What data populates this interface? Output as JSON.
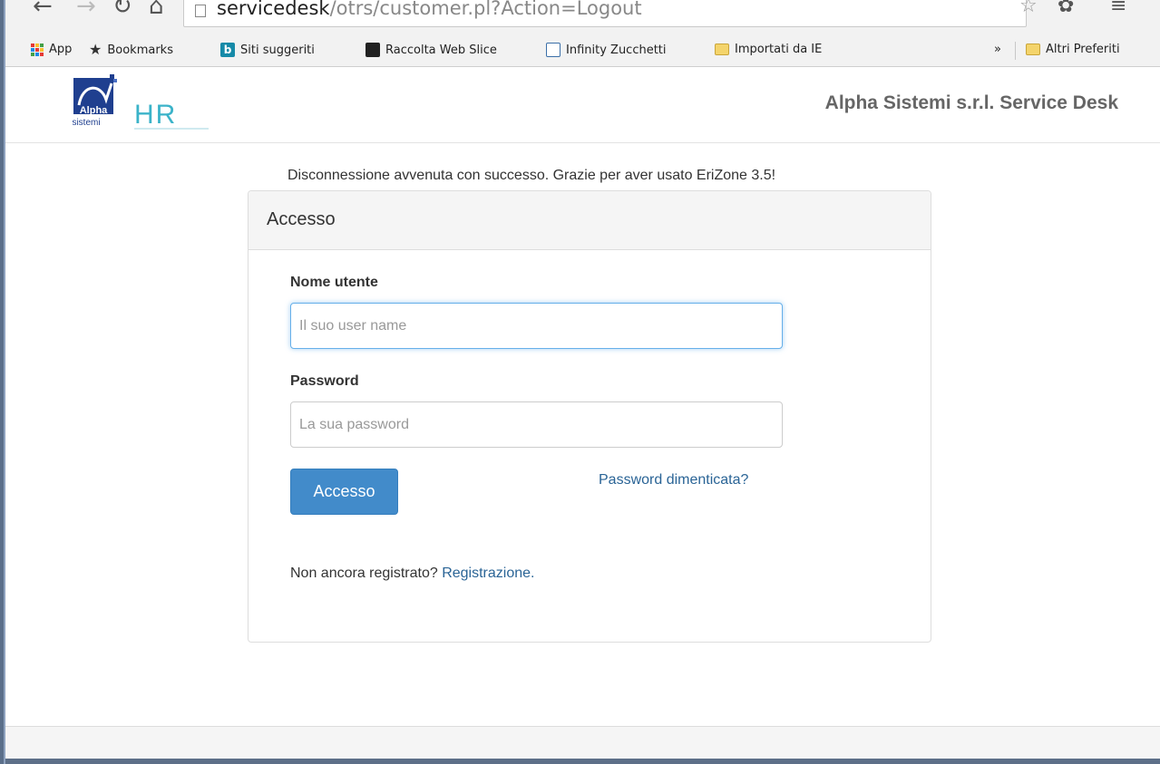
{
  "browser": {
    "url_host": "servicedesk",
    "url_path": "/otrs/customer.pl?Action=Logout",
    "bookmarks": [
      {
        "label": "App",
        "icon": "apps-grid-icon"
      },
      {
        "label": "Bookmarks",
        "icon": "star-icon"
      },
      {
        "label": "Siti suggeriti",
        "icon": "bing-icon"
      },
      {
        "label": "Raccolta Web Slice",
        "icon": "web-slice-icon"
      },
      {
        "label": "Infinity Zucchetti",
        "icon": "infinity-icon"
      },
      {
        "label": "Importati da IE",
        "icon": "folder-icon"
      }
    ],
    "overflow_label": "»",
    "other_bookmarks": "Altri Preferiti"
  },
  "header": {
    "logo_alpha_top": "Alpha",
    "logo_alpha_bottom": "sistemi",
    "logo_hr": "HR",
    "site_title": "Alpha Sistemi s.r.l. Service Desk"
  },
  "main": {
    "success_message": "Disconnessione avvenuta con successo. Grazie per aver usato EriZone 3.5!",
    "panel_title": "Accesso",
    "username_label": "Nome utente",
    "username_placeholder": "Il suo user name",
    "password_label": "Password",
    "password_placeholder": "La sua password",
    "login_button": "Accesso",
    "forgot_link": "Password dimenticata?",
    "register_prompt": "Non ancora registrato?",
    "register_link": "Registrazione."
  },
  "colors": {
    "primary_button": "#428bca",
    "link": "#2a6496",
    "focus_border": "#66afe9"
  }
}
